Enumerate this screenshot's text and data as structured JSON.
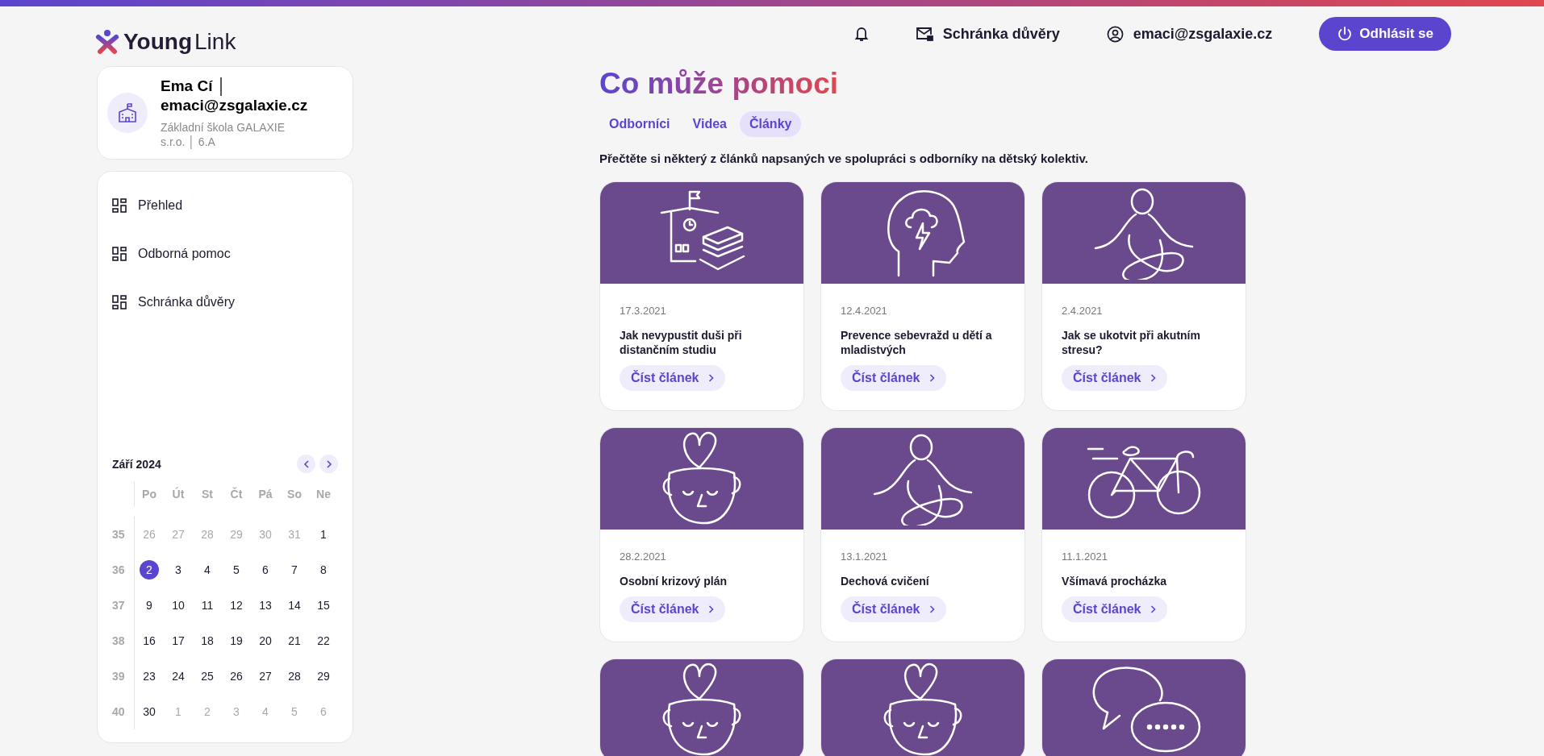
{
  "logo": {
    "bold": "Young",
    "light": "Link"
  },
  "header": {
    "mailbox": "Schránka důvěry",
    "user": "emaci@zsgalaxie.cz",
    "logout": "Odhlásit se"
  },
  "profile": {
    "name": "Ema Cí │ emaci@zsgalaxie.cz",
    "school": "Základní škola GALAXIE s.r.o. │ 6.A"
  },
  "nav": [
    {
      "label": "Přehled"
    },
    {
      "label": "Odborná pomoc"
    },
    {
      "label": "Schránka důvěry"
    }
  ],
  "calendar": {
    "month": "Září 2024",
    "weekdays": [
      "Po",
      "Út",
      "St",
      "Čt",
      "Pá",
      "So",
      "Ne"
    ],
    "weeks": [
      {
        "number": "35",
        "days": [
          {
            "d": "26",
            "muted": true,
            "selected": false
          },
          {
            "d": "27",
            "muted": true,
            "selected": false
          },
          {
            "d": "28",
            "muted": true,
            "selected": false
          },
          {
            "d": "29",
            "muted": true,
            "selected": false
          },
          {
            "d": "30",
            "muted": true,
            "selected": false
          },
          {
            "d": "31",
            "muted": true,
            "selected": false
          },
          {
            "d": "1",
            "muted": false,
            "selected": false
          }
        ]
      },
      {
        "number": "36",
        "days": [
          {
            "d": "2",
            "muted": false,
            "selected": true
          },
          {
            "d": "3",
            "muted": false,
            "selected": false
          },
          {
            "d": "4",
            "muted": false,
            "selected": false
          },
          {
            "d": "5",
            "muted": false,
            "selected": false
          },
          {
            "d": "6",
            "muted": false,
            "selected": false
          },
          {
            "d": "7",
            "muted": false,
            "selected": false
          },
          {
            "d": "8",
            "muted": false,
            "selected": false
          }
        ]
      },
      {
        "number": "37",
        "days": [
          {
            "d": "9",
            "muted": false,
            "selected": false
          },
          {
            "d": "10",
            "muted": false,
            "selected": false
          },
          {
            "d": "11",
            "muted": false,
            "selected": false
          },
          {
            "d": "12",
            "muted": false,
            "selected": false
          },
          {
            "d": "13",
            "muted": false,
            "selected": false
          },
          {
            "d": "14",
            "muted": false,
            "selected": false
          },
          {
            "d": "15",
            "muted": false,
            "selected": false
          }
        ]
      },
      {
        "number": "38",
        "days": [
          {
            "d": "16",
            "muted": false,
            "selected": false
          },
          {
            "d": "17",
            "muted": false,
            "selected": false
          },
          {
            "d": "18",
            "muted": false,
            "selected": false
          },
          {
            "d": "19",
            "muted": false,
            "selected": false
          },
          {
            "d": "20",
            "muted": false,
            "selected": false
          },
          {
            "d": "21",
            "muted": false,
            "selected": false
          },
          {
            "d": "22",
            "muted": false,
            "selected": false
          }
        ]
      },
      {
        "number": "39",
        "days": [
          {
            "d": "23",
            "muted": false,
            "selected": false
          },
          {
            "d": "24",
            "muted": false,
            "selected": false
          },
          {
            "d": "25",
            "muted": false,
            "selected": false
          },
          {
            "d": "26",
            "muted": false,
            "selected": false
          },
          {
            "d": "27",
            "muted": false,
            "selected": false
          },
          {
            "d": "28",
            "muted": false,
            "selected": false
          },
          {
            "d": "29",
            "muted": false,
            "selected": false
          }
        ]
      },
      {
        "number": "40",
        "days": [
          {
            "d": "30",
            "muted": false,
            "selected": false
          },
          {
            "d": "1",
            "muted": true,
            "selected": false
          },
          {
            "d": "2",
            "muted": true,
            "selected": false
          },
          {
            "d": "3",
            "muted": true,
            "selected": false
          },
          {
            "d": "4",
            "muted": true,
            "selected": false
          },
          {
            "d": "5",
            "muted": true,
            "selected": false
          },
          {
            "d": "6",
            "muted": true,
            "selected": false
          }
        ]
      }
    ]
  },
  "title": "Co může pomoci",
  "tabs": [
    {
      "label": "Odborníci",
      "selected": false
    },
    {
      "label": "Videa",
      "selected": false
    },
    {
      "label": "Články",
      "selected": true
    }
  ],
  "intro": "Přečtěte si některý z článků napsaných ve spolupráci s odborníky na dětský kolektiv.",
  "articles": [
    {
      "kind": "school",
      "date": "17.3.2021",
      "title": "Jak nevypustit duši při distančním studiu",
      "button": "Číst článek"
    },
    {
      "kind": "head",
      "date": "12.4.2021",
      "title": "Prevence sebevražd u dětí a mladistvých",
      "button": "Číst článek"
    },
    {
      "kind": "meditation",
      "date": "2.4.2021",
      "title": "Jak se ukotvit při akutním stresu?",
      "button": "Číst článek"
    },
    {
      "kind": "cup",
      "date": "28.2.2021",
      "title": "Osobní krizový plán",
      "button": "Číst článek"
    },
    {
      "kind": "meditation",
      "date": "13.1.2021",
      "title": "Dechová cvičení",
      "button": "Číst článek"
    },
    {
      "kind": "bicycle",
      "date": "11.1.2021",
      "title": "Všímavá procházka",
      "button": "Číst článek"
    },
    {
      "kind": "cup"
    },
    {
      "kind": "cup"
    },
    {
      "kind": "chat"
    }
  ]
}
